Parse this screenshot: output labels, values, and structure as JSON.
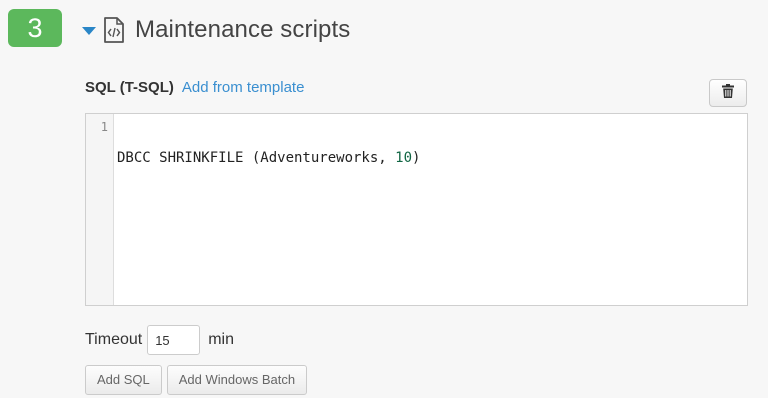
{
  "step": {
    "number": "3"
  },
  "section": {
    "title": "Maintenance scripts",
    "icon": "code-file-icon",
    "expanded": true
  },
  "sql_editor": {
    "label": "SQL (T-SQL)",
    "template_link": "Add from template",
    "delete_icon": "trash-icon",
    "lines": [
      {
        "number": "1",
        "text_prefix": "DBCC SHRINKFILE (Adventureworks, ",
        "text_number": "10",
        "text_suffix": ")"
      }
    ]
  },
  "timeout": {
    "label": "Timeout",
    "value": "15",
    "unit": "min"
  },
  "actions": {
    "add_sql": "Add SQL",
    "add_windows_batch": "Add Windows Batch"
  },
  "colors": {
    "badge": "#5cb85c",
    "link": "#3a8fd0",
    "caret": "#2a86c7"
  }
}
